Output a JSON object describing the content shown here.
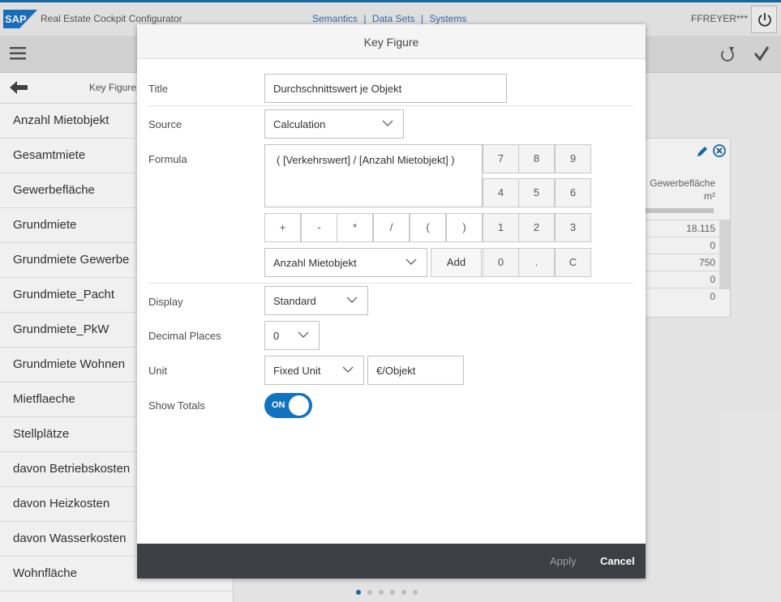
{
  "shell": {
    "app_title": "Real Estate Cockpit Configurator",
    "links": [
      "Semantics",
      "Data Sets",
      "Systems"
    ],
    "separator": "|",
    "user": "FFREYER***"
  },
  "sidebar": {
    "title": "Key Figure",
    "items": [
      "Anzahl Mietobjekt",
      "Gesamtmiete",
      "Gewerbefläche",
      "Grundmiete",
      "Grundmiete Gewerbe",
      "Grundmiete_Pacht",
      "Grundmiete_PkW",
      "Grundmiete Wohnen",
      "Mietflaeche",
      "Stellplätze",
      "davon Betriebskosten",
      "davon Heizkosten",
      "davon Wasserkosten",
      "Wohnfläche"
    ]
  },
  "bg_card": {
    "column_header": "Gewerbefläche",
    "column_unit": "m²",
    "rows": [
      "18.115",
      "0",
      "750",
      "0",
      "0"
    ]
  },
  "dialog": {
    "title": "Key Figure",
    "labels": {
      "title": "Title",
      "source": "Source",
      "formula": "Formula",
      "display": "Display",
      "decimal_places": "Decimal Places",
      "unit": "Unit",
      "show_totals": "Show Totals"
    },
    "title_value": "Durchschnittswert je Objekt",
    "source_value": "Calculation",
    "formula_value": "( [Verkehrswert] / [Anzahl Mietobjekt] )",
    "keypad": {
      "operators": [
        "+",
        "-",
        "*",
        "/",
        "(",
        ")"
      ],
      "digits_row1": [
        "7",
        "8",
        "9"
      ],
      "digits_row2": [
        "4",
        "5",
        "6"
      ],
      "digits_row3": [
        "1",
        "2",
        "3"
      ],
      "digits_row4": [
        "0",
        ".",
        "C"
      ]
    },
    "key_figure_select": "Anzahl Mietobjekt",
    "add_label": "Add",
    "display_value": "Standard",
    "decimal_value": "0",
    "unit_type": "Fixed Unit",
    "unit_value": "€/Objekt",
    "show_totals": "ON",
    "apply_label": "Apply",
    "cancel_label": "Cancel"
  },
  "colors": {
    "accent": "#1073c0",
    "footer": "#3c3f44",
    "shell_border": "#1b6ea8"
  }
}
